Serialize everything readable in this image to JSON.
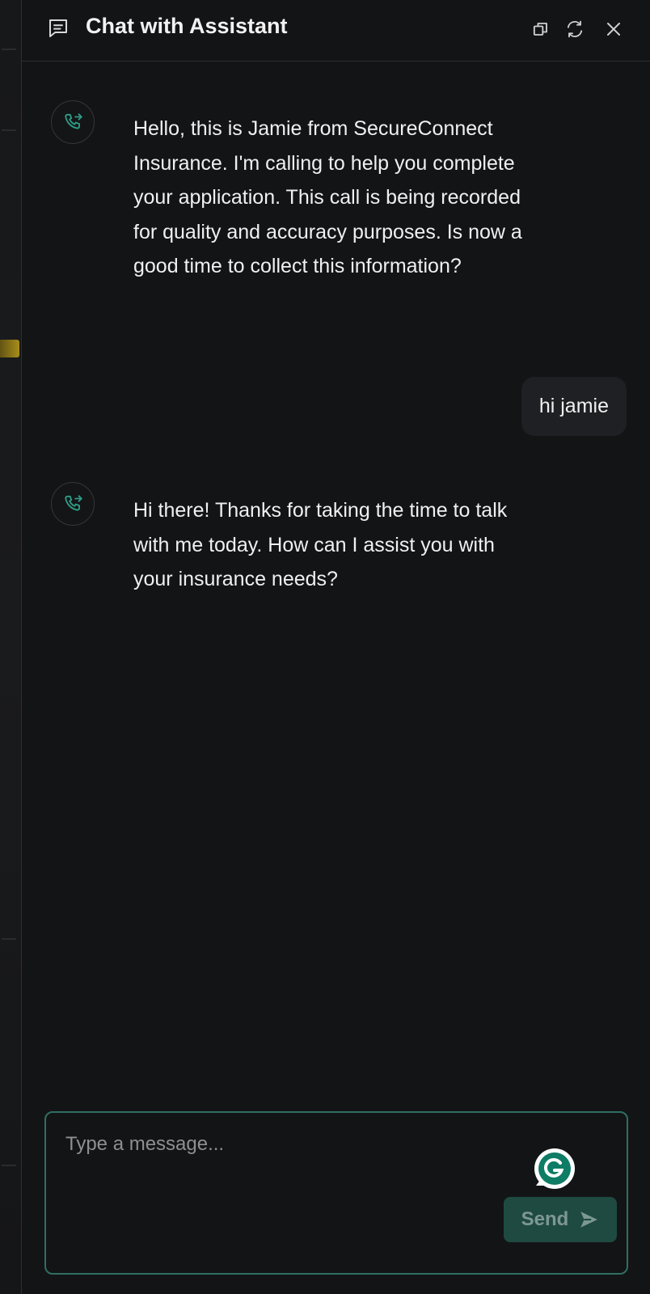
{
  "header": {
    "title": "Chat with Assistant",
    "icons": [
      "chat-icon",
      "popout-icon",
      "refresh-icon",
      "close-icon"
    ]
  },
  "messages": [
    {
      "role": "assistant",
      "avatar_icon": "phone-forward-icon",
      "text": "Hello, this is Jamie from SecureConnect Insurance. I'm calling to help you complete your application. This call is being recorded for quality and accuracy purposes. Is now a good time to collect this information?"
    },
    {
      "role": "user",
      "text": "hi jamie"
    },
    {
      "role": "assistant",
      "avatar_icon": "phone-forward-icon",
      "text": "Hi there! Thanks for taking the time to talk with me today. How can I assist you with your insurance needs?"
    }
  ],
  "composer": {
    "placeholder": "Type a message...",
    "value": "",
    "send_label": "Send",
    "send_icon": "send-arrow-icon",
    "grammarly_icon": "grammarly-icon"
  },
  "colors": {
    "background": "#131416",
    "accent": "#2e9e86",
    "user_bubble": "#1f2023",
    "send_button": "#1f4a42"
  }
}
